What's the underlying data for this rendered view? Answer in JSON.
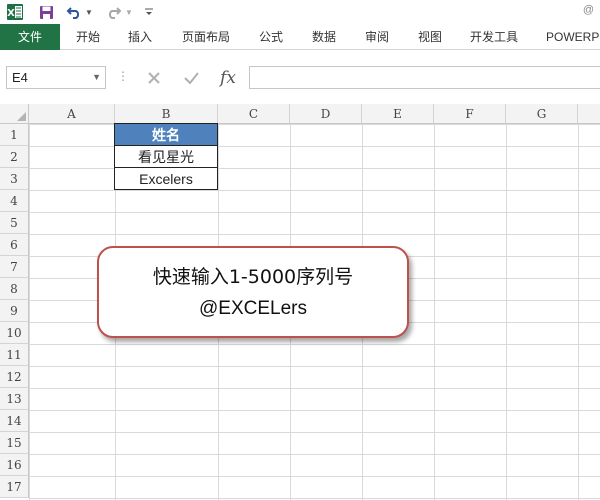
{
  "quick_access": {
    "icons": [
      "excel-logo-icon",
      "save-icon",
      "undo-icon",
      "redo-icon",
      "customize-icon"
    ],
    "excel_logo": "X",
    "right_text": "@"
  },
  "ribbon": {
    "tabs": [
      "文件",
      "开始",
      "插入",
      "页面布局",
      "公式",
      "数据",
      "审阅",
      "视图",
      "开发工具",
      "POWERP"
    ],
    "file_color": "#217346"
  },
  "formula_bar": {
    "name_box": "E4",
    "separator": "⋮",
    "fx_label": "fx",
    "formula": ""
  },
  "grid": {
    "columns": [
      "A",
      "B",
      "C",
      "D",
      "E",
      "F",
      "G"
    ],
    "rows": [
      "1",
      "2",
      "3",
      "4",
      "5",
      "6",
      "7",
      "8",
      "9",
      "10",
      "11",
      "12",
      "13",
      "14",
      "15",
      "16",
      "17"
    ],
    "cells": {
      "B1": "姓名",
      "B2": "看见星光",
      "B3": "Excelers"
    },
    "header_color": "#4f81bd"
  },
  "callout": {
    "line1": "快速输入1-5000序列号",
    "line2": "@EXCELers",
    "border_color": "#c0504d"
  }
}
